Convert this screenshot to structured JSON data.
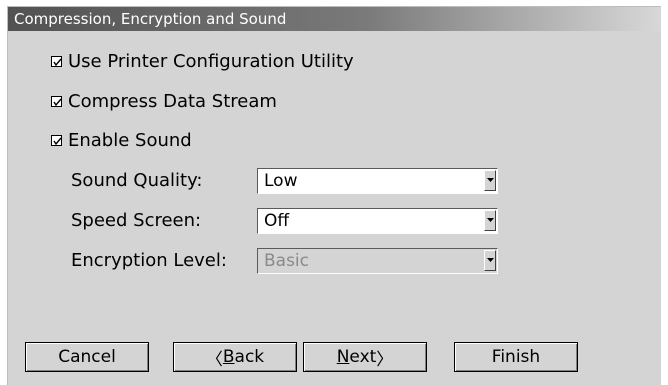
{
  "dialog": {
    "title": "Compression, Encryption and Sound"
  },
  "options": {
    "printer_config": {
      "label": "Use Printer Configuration Utility",
      "checked": true
    },
    "compress": {
      "label": "Compress Data Stream",
      "checked": true
    },
    "sound": {
      "label": "Enable Sound",
      "checked": true
    }
  },
  "fields": {
    "sound_quality": {
      "label": "Sound Quality:",
      "value": "Low",
      "enabled": true
    },
    "speed_screen": {
      "label": "Speed Screen:",
      "value": "Off",
      "enabled": true
    },
    "encryption_level": {
      "label": "Encryption Level:",
      "value": "Basic",
      "enabled": false
    }
  },
  "buttons": {
    "cancel": "Cancel",
    "back_prefix": "〈",
    "back_mnemonic": "B",
    "back_rest": "ack",
    "next_mnemonic": "N",
    "next_rest": "ext",
    "next_suffix": "〉",
    "finish": "Finish"
  },
  "icons": {
    "checkmark": "checkmark-icon",
    "dropdown_arrow": "chevron-down-icon"
  }
}
